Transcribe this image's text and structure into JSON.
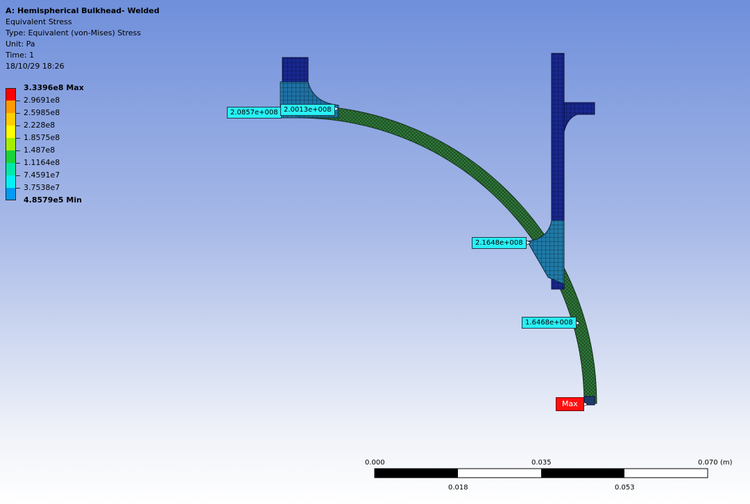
{
  "header": {
    "title": "A: Hemispherical Bulkhead- Welded",
    "result_name": "Equivalent Stress",
    "type": "Type: Equivalent (von-Mises) Stress",
    "unit": "Unit: Pa",
    "time": "Time: 1",
    "date": "18/10/29 18:26"
  },
  "legend": {
    "items": [
      {
        "label": "3.3396e8 Max",
        "color": "#ff0000",
        "bold": true
      },
      {
        "label": "2.9691e8",
        "color": "#ff9a00",
        "bold": false
      },
      {
        "label": "2.5985e8",
        "color": "#ffce00",
        "bold": false
      },
      {
        "label": "2.228e8",
        "color": "#ffff00",
        "bold": false
      },
      {
        "label": "1.8575e8",
        "color": "#a6ee00",
        "bold": false
      },
      {
        "label": "1.487e8",
        "color": "#1cd43a",
        "bold": false
      },
      {
        "label": "1.1164e8",
        "color": "#00e8a8",
        "bold": false
      },
      {
        "label": "7.4591e7",
        "color": "#00f2f5",
        "bold": false
      },
      {
        "label": "3.7538e7",
        "color": "#009bf2",
        "bold": false
      },
      {
        "label": "4.8579e5 Min",
        "color": "#0000e8",
        "bold": true
      }
    ]
  },
  "probes": {
    "p1": "2.0857e+008",
    "p2": "2.0013e+008",
    "p3": "2.1648e+008",
    "p4": "1.6468e+008",
    "max": "Max"
  },
  "scale_bar": {
    "top_labels": [
      "0.000",
      "0.035",
      "0.070"
    ],
    "unit": "(m)",
    "bottom_labels": [
      "0.018",
      "0.053"
    ]
  },
  "colors": {
    "mesh_shell": "#2f7a38",
    "mesh_line": "#14301a",
    "dark_blue": "#16217a",
    "probe": "#28f0f5",
    "max_probe": "#ff1010"
  }
}
